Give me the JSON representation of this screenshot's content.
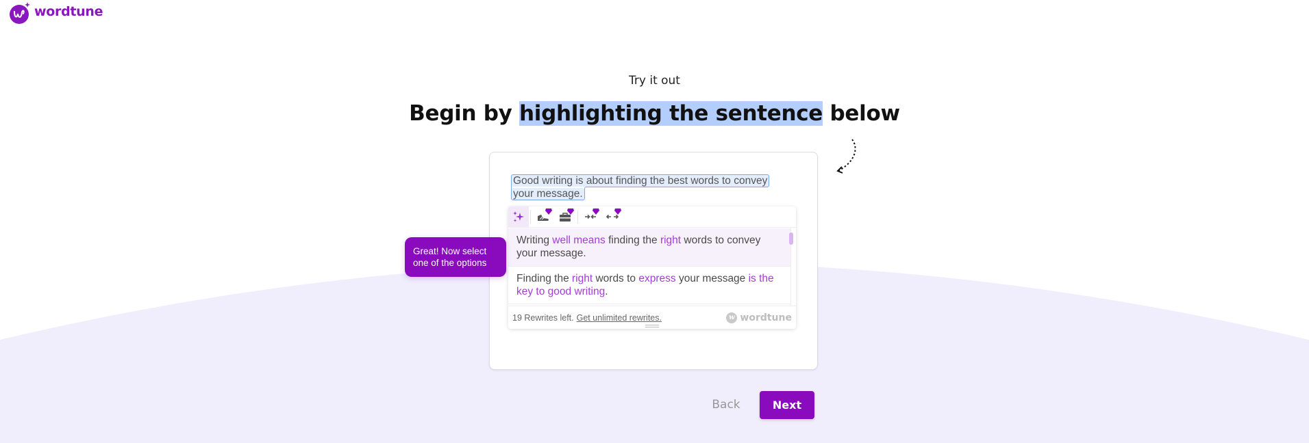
{
  "brand": {
    "name": "wordtune",
    "color": "#8a17bd"
  },
  "intro": {
    "eyebrow": "Try it out",
    "headline_before": "Begin by ",
    "headline_highlight": "highlighting the sentence",
    "headline_after": " below"
  },
  "editor": {
    "sentence": "Good writing is about finding the best words to convey your message."
  },
  "rewrite_popup": {
    "toolbar": [
      {
        "name": "rewrite",
        "icon": "sparkles-icon",
        "active": true,
        "premium": false
      },
      {
        "name": "casual",
        "icon": "sneaker-icon",
        "active": false,
        "premium": true
      },
      {
        "name": "formal",
        "icon": "briefcase-icon",
        "active": false,
        "premium": true
      },
      {
        "name": "shorten",
        "icon": "shorten-arrows-icon",
        "active": false,
        "premium": true
      },
      {
        "name": "expand",
        "icon": "expand-arrows-icon",
        "active": false,
        "premium": true
      }
    ],
    "options": [
      {
        "segments": [
          {
            "text": "Writing ",
            "changed": false
          },
          {
            "text": "well means",
            "changed": true
          },
          {
            "text": " finding the ",
            "changed": false
          },
          {
            "text": "right",
            "changed": true
          },
          {
            "text": " words to convey your message.",
            "changed": false
          }
        ],
        "selected": true
      },
      {
        "segments": [
          {
            "text": "Finding the ",
            "changed": false
          },
          {
            "text": "right",
            "changed": true
          },
          {
            "text": " words to ",
            "changed": false
          },
          {
            "text": "express",
            "changed": true
          },
          {
            "text": " your message ",
            "changed": false
          },
          {
            "text": "is the key to good writing",
            "changed": true
          },
          {
            "text": ".",
            "changed": false
          }
        ],
        "selected": false
      }
    ],
    "footer": {
      "rewrites_left": "19 Rewrites left.",
      "upgrade_link": "Get unlimited rewrites.",
      "brand": "wordtune"
    }
  },
  "tooltip": {
    "text": "Great! Now select one of the options"
  },
  "navigation": {
    "back_label": "Back",
    "next_label": "Next"
  },
  "colors": {
    "accent": "#8a0bbd",
    "highlight": "#b3cefb",
    "changed_word": "#a53bd8",
    "background_wave": "#f0eefd"
  }
}
